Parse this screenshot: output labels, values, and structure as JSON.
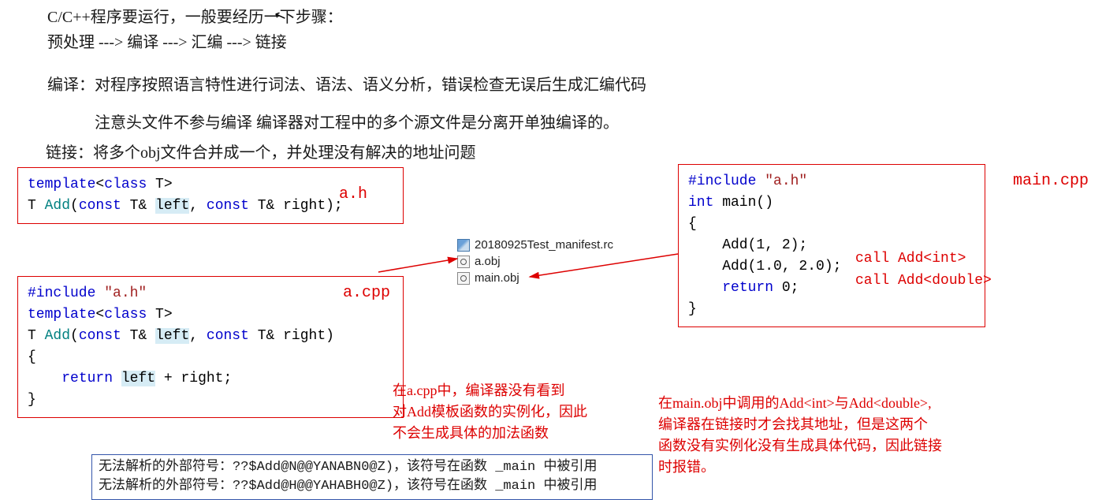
{
  "intro": {
    "line1": "C/C++程序要运行，一般要经历一下步骤：",
    "line2": "预处理 ---> 编译 ---> 汇编 ---> 链接",
    "para1": "编译：对程序按照语言特性进行词法、语法、语义分析，错误检查无误后生成汇编代码",
    "para2": "注意头文件不参与编译  编译器对工程中的多个源文件是分离开单独编译的。",
    "para3": "链接：将多个obj文件合并成一个，并处理没有解决的地址问题"
  },
  "labels": {
    "ah": "a.h",
    "acpp": "a.cpp",
    "maincpp": "main.cpp"
  },
  "code_ah": {
    "l1a": "template",
    "l1b": "<",
    "l1c": "class",
    "l1d": " T>",
    "l2a": "T ",
    "l2b": "Add",
    "l2c": "(",
    "l2d": "const",
    "l2e": " T& ",
    "l2f": "left",
    "l2g": ", ",
    "l2h": "const",
    "l2i": " T& right);"
  },
  "code_acpp": {
    "l1a": "#include ",
    "l1b": "\"a.h\"",
    "l2a": "template",
    "l2b": "<",
    "l2c": "class",
    "l2d": " T>",
    "l3a": "T ",
    "l3b": "Add",
    "l3c": "(",
    "l3d": "const",
    "l3e": " T& ",
    "l3f": "left",
    "l3g": ", ",
    "l3h": "const",
    "l3i": " T& right)",
    "l4": "{",
    "l5a": "    ",
    "l5b": "return",
    "l5c": " ",
    "l5d": "left",
    "l5e": " + right;",
    "l6": "}"
  },
  "code_main": {
    "l1a": "#include ",
    "l1b": "\"a.h\"",
    "l2a": "int",
    "l2b": " main()",
    "l3": "{",
    "l4": "    Add(1, 2);",
    "l5": "    Add(1.0, 2.0);",
    "l6a": "    ",
    "l6b": "return",
    "l6c": " 0;",
    "l7": "}"
  },
  "call1": "call Add<int>",
  "call2": "call Add<double>",
  "files": {
    "f1": "20180925Test_manifest.rc",
    "f2": "a.obj",
    "f3": "main.obj"
  },
  "note_acpp": {
    "l1": "在a.cpp中，编译器没有看到",
    "l2": "对Add模板函数的实例化，因此",
    "l3": "不会生成具体的加法函数"
  },
  "note_main": {
    "l1": "在main.obj中调用的Add<int>与Add<double>,",
    "l2": "编译器在链接时才会找其地址，但是这两个",
    "l3": "函数没有实例化没有生成具体代码，因此链接",
    "l4": "时报错。"
  },
  "errors": {
    "l1": "无法解析的外部符号：??$Add@N@@YANABN0@Z)，该符号在函数 _main 中被引用",
    "l2": "无法解析的外部符号：??$Add@H@@YAHABH0@Z)，该符号在函数 _main 中被引用"
  }
}
